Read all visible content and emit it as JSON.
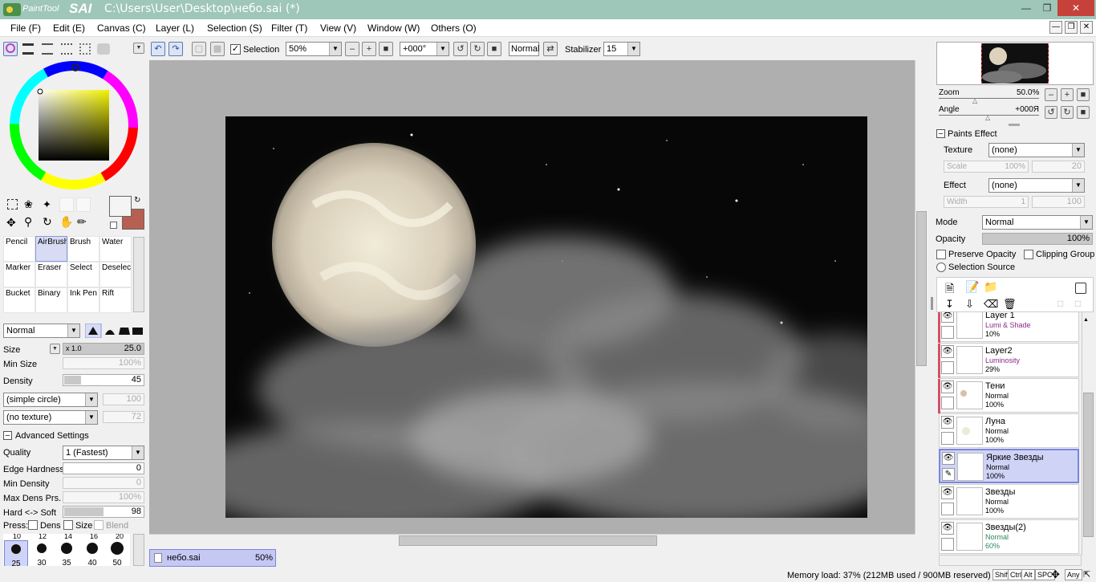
{
  "app": {
    "title": "C:\\Users\\User\\Desktop\\небо.sai (*)",
    "logo_small": "PaintTool",
    "logo_big": "SAI"
  },
  "menu": [
    "File (F)",
    "Edit (E)",
    "Canvas (C)",
    "Layer (L)",
    "Selection (S)",
    "Filter (T)",
    "View (V)",
    "Window (W)",
    "Others (O)"
  ],
  "toolbar": {
    "selection_label": "Selection",
    "zoom": "50%",
    "angle": "+000°",
    "blend": "Normal",
    "stabilizer_label": "Stabilizer",
    "stabilizer": "15"
  },
  "tools": [
    {
      "label": "Pencil"
    },
    {
      "label": "AirBrush"
    },
    {
      "label": "Brush"
    },
    {
      "label": "Water"
    },
    {
      "label": "Marker"
    },
    {
      "label": "Eraser"
    },
    {
      "label": "Select"
    },
    {
      "label": "Deselect"
    },
    {
      "label": "Bucket"
    },
    {
      "label": "Binary"
    },
    {
      "label": "Ink Pen"
    },
    {
      "label": "Rift"
    }
  ],
  "brush": {
    "mode": "Normal",
    "size_label": "Size",
    "size_mult": "x 1.0",
    "size": "25.0",
    "min_size_label": "Min Size",
    "min_size": "100%",
    "density_label": "Density",
    "density": "45",
    "density_pct": 45,
    "shape": "(simple circle)",
    "shape_val": "100",
    "texture": "(no texture)",
    "texture_val": "72",
    "advanced_label": "Advanced Settings",
    "quality_label": "Quality",
    "quality": "1 (Fastest)",
    "edge_label": "Edge Hardness",
    "edge": "0",
    "min_density_label": "Min Density",
    "min_density": "0",
    "max_dens_label": "Max Dens Prs.",
    "max_dens": "100%",
    "hard_soft_label": "Hard <-> Soft",
    "hard_soft": "98",
    "hard_soft_pct": 98,
    "press_label": "Press:",
    "press_dens": "Dens",
    "press_size": "Size",
    "press_blend": "Blend",
    "sizes_top": [
      "10",
      "12",
      "14",
      "16",
      "20"
    ],
    "sizes": [
      "25",
      "30",
      "35",
      "40",
      "50"
    ]
  },
  "colors": {
    "primary": "#f4f4f4",
    "secondary": "#b75f50",
    "accent": "#7b86da"
  },
  "navigator": {
    "zoom_label": "Zoom",
    "zoom": "50.0%",
    "angle_label": "Angle",
    "angle": "+000Я"
  },
  "paints_effect": {
    "title": "Paints Effect",
    "texture_label": "Texture",
    "texture": "(none)",
    "scale_label": "Scale",
    "scale": "100%",
    "scale_val": "20",
    "effect_label": "Effect",
    "effect": "(none)",
    "width_label": "Width",
    "width": "1",
    "width_val": "100"
  },
  "layer_props": {
    "mode_label": "Mode",
    "mode": "Normal",
    "opacity_label": "Opacity",
    "opacity": "100%",
    "preserve": "Preserve Opacity",
    "clipping": "Clipping Group",
    "selsrc": "Selection Source"
  },
  "layers": [
    {
      "name": "Layer 1",
      "mode": "Lumi & Shade",
      "opacity": "10%",
      "mode_color": "#8a2a8a",
      "red": true
    },
    {
      "name": "Layer2",
      "mode": "Luminosity",
      "opacity": "29%",
      "mode_color": "#8a2a8a",
      "red": true
    },
    {
      "name": "Тени",
      "mode": "Normal",
      "opacity": "100%",
      "mode_color": "#000",
      "red": true
    },
    {
      "name": "Луна",
      "mode": "Normal",
      "opacity": "100%",
      "mode_color": "#000",
      "red": false
    },
    {
      "name": "Яркие Звезды",
      "mode": "Normal",
      "opacity": "100%",
      "mode_color": "#000",
      "red": false,
      "active": true
    },
    {
      "name": "Звезды",
      "mode": "Normal",
      "opacity": "100%",
      "mode_color": "#000",
      "red": false
    },
    {
      "name": "Звезды(2)",
      "mode": "Normal",
      "opacity": "60%",
      "mode_color": "#2a8a5a",
      "red": false
    }
  ],
  "document_tab": {
    "name": "небо.sai",
    "zoom": "50%"
  },
  "status": {
    "memory": "Memory load: 37% (212MB used / 900MB reserved)",
    "keys": [
      "Shift",
      "Ctrl",
      "Alt",
      "SPC",
      "Any"
    ]
  }
}
